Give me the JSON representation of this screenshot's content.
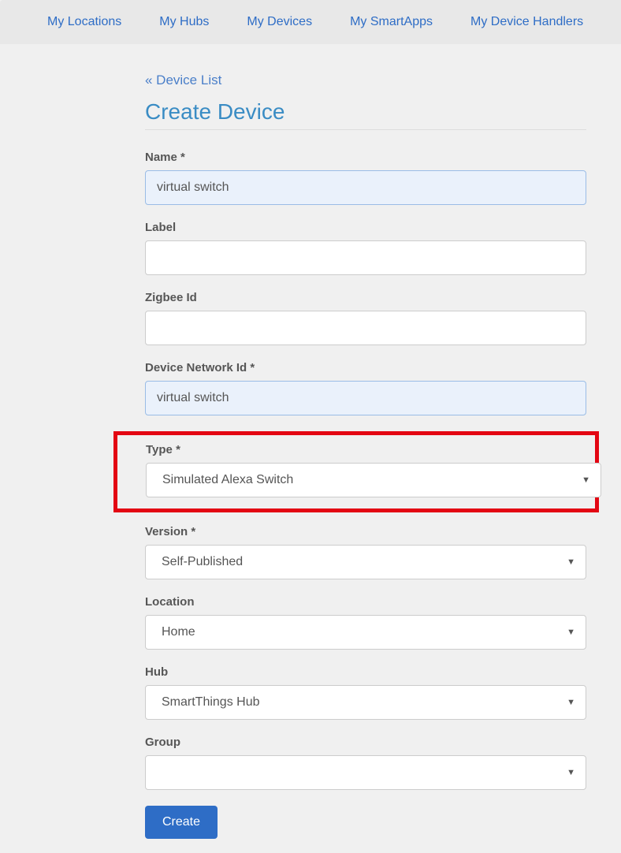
{
  "nav": {
    "locations": "My Locations",
    "hubs": "My Hubs",
    "devices": "My Devices",
    "smartapps": "My SmartApps",
    "handlers": "My Device Handlers"
  },
  "back_link": "« Device List",
  "page_title": "Create Device",
  "form": {
    "name": {
      "label": "Name *",
      "value": "virtual switch"
    },
    "label": {
      "label": "Label",
      "value": ""
    },
    "zigbee_id": {
      "label": "Zigbee Id",
      "value": ""
    },
    "device_network_id": {
      "label": "Device Network Id *",
      "value": "virtual switch"
    },
    "type": {
      "label": "Type *",
      "selected": "Simulated Alexa Switch"
    },
    "version": {
      "label": "Version *",
      "selected": "Self-Published"
    },
    "location": {
      "label": "Location",
      "selected": "Home"
    },
    "hub": {
      "label": "Hub",
      "selected": "SmartThings Hub"
    },
    "group": {
      "label": "Group",
      "selected": ""
    }
  },
  "submit_label": "Create"
}
